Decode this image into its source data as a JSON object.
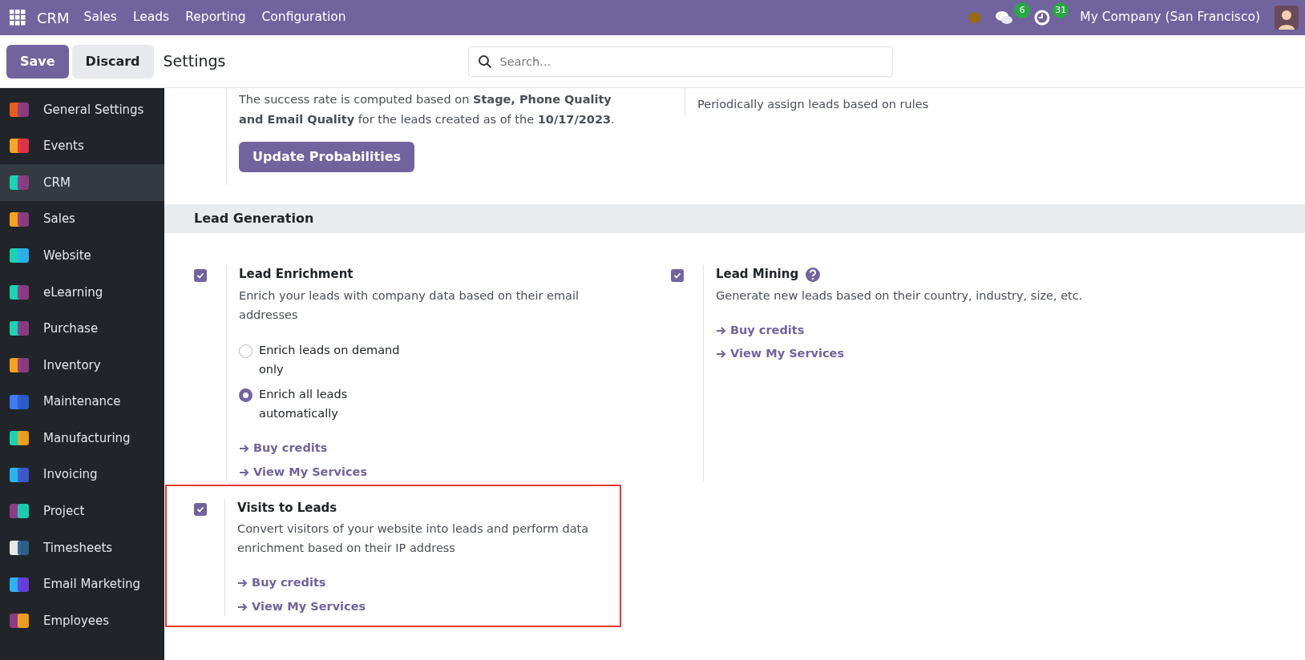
{
  "navbar": {
    "app": "CRM",
    "menus": [
      "Sales",
      "Leads",
      "Reporting",
      "Configuration"
    ],
    "messages_count": "6",
    "activities_count": "31",
    "company": "My Company (San Francisco)"
  },
  "control_panel": {
    "buttons": [
      {
        "label": "Save",
        "kind": "primary"
      },
      {
        "label": "Discard",
        "kind": "secondary"
      }
    ],
    "title": "Settings",
    "search": {
      "placeholder": "Search..."
    }
  },
  "sidebar": {
    "items": [
      {
        "label": "General Settings",
        "selected": false
      },
      {
        "label": "Events",
        "selected": false
      },
      {
        "label": "CRM",
        "selected": true
      },
      {
        "label": "Sales",
        "selected": false
      },
      {
        "label": "Website",
        "selected": false
      },
      {
        "label": "eLearning",
        "selected": false
      },
      {
        "label": "Purchase",
        "selected": false
      },
      {
        "label": "Inventory",
        "selected": false
      },
      {
        "label": "Maintenance",
        "selected": false
      },
      {
        "label": "Manufacturing",
        "selected": false
      },
      {
        "label": "Invoicing",
        "selected": false
      },
      {
        "label": "Project",
        "selected": false
      },
      {
        "label": "Timesheets",
        "selected": false
      },
      {
        "label": "Email Marketing",
        "selected": false
      },
      {
        "label": "Employees",
        "selected": false
      }
    ]
  },
  "top_partial": {
    "left": {
      "description": "The success rate is computed based on **Stage, Phone Quality and Email Quality** for the leads created as of the **10/17/2023**.",
      "button": "Update Probabilities"
    },
    "right": {
      "description": "Periodically assign leads based on rules"
    }
  },
  "sections": [
    {
      "title": "Lead Generation",
      "settings": [
        {
          "title": "Lead Enrichment",
          "checked": true,
          "help": false,
          "highlighted": false,
          "description": "Enrich your leads with company data based on their email addresses",
          "options": [
            {
              "label": "Enrich leads on demand only",
              "selected": false
            },
            {
              "label": "Enrich all leads automatically",
              "selected": true
            }
          ],
          "links": [
            "Buy credits",
            "View My Services"
          ]
        },
        {
          "title": "Lead Mining",
          "checked": true,
          "help": true,
          "highlighted": false,
          "description": "Generate new leads based on their country, industry, size, etc.",
          "links": [
            "Buy credits",
            "View My Services"
          ]
        },
        {
          "title": "Visits to Leads",
          "checked": true,
          "help": false,
          "highlighted": true,
          "description": "Convert visitors of your website into leads and perform data enrichment based on their IP address",
          "links": [
            "Buy credits",
            "View My Services"
          ]
        }
      ]
    }
  ]
}
